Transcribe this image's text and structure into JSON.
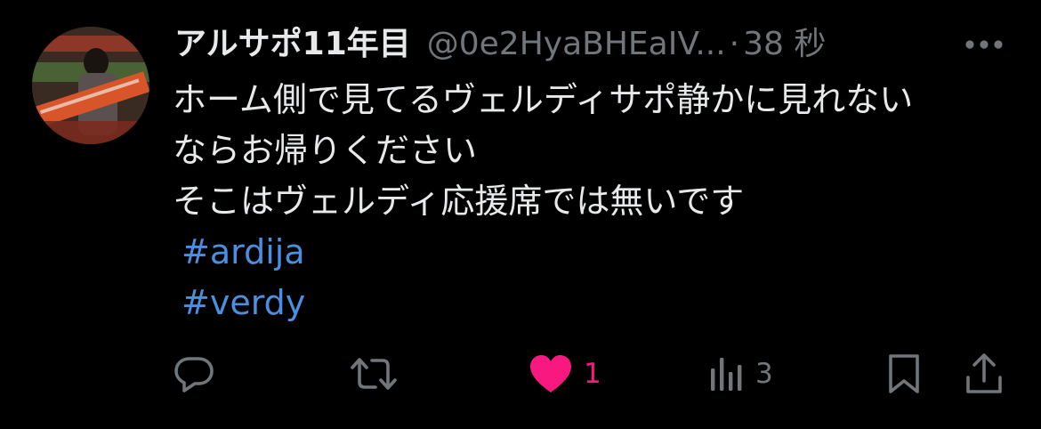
{
  "user": {
    "display_name": "アルサポ11年目",
    "handle": "@0e2HyaBHEaIV...",
    "separator": "·",
    "time": "38 秒"
  },
  "post": {
    "lines": [
      "ホーム側で見てるヴェルディサポ静かに見れない",
      "ならお帰りください",
      "そこはヴェルディ応援席では無いです"
    ],
    "hashtags": [
      "#ardija",
      "#verdy"
    ]
  },
  "actions": {
    "reply_count": "",
    "repost_count": "",
    "like_count": "1",
    "views_count": "3"
  },
  "icons": {
    "more": "more-horizontal-icon",
    "reply": "reply-icon",
    "repost": "repost-icon",
    "like": "heart-icon",
    "views": "views-icon",
    "bookmark": "bookmark-icon",
    "share": "share-icon"
  },
  "colors": {
    "background": "#000000",
    "text": "#e7e9ea",
    "muted": "#71767b",
    "hashtag": "#4a8fe0",
    "like": "#f91880"
  }
}
